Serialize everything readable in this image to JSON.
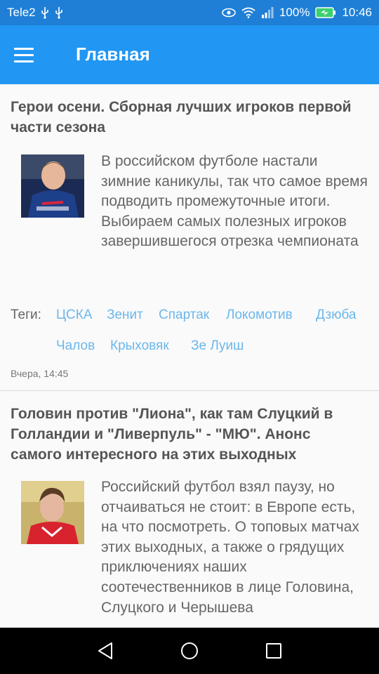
{
  "status_bar": {
    "carrier": "Tele2",
    "battery": "100%",
    "time": "10:46"
  },
  "app_bar": {
    "title": "Главная"
  },
  "tags_label": "Теги:",
  "articles": [
    {
      "title": "Герои осени. Сборная лучших игроков первой части сезона",
      "text": "В российском футболе настали зимние каникулы, так что самое время подводить промежуточные итоги. Выбираем самых полезных игроков завершившегося отрезка чемпионата",
      "tags": [
        "ЦСКА",
        "Зенит",
        "Спартак",
        "Локомотив",
        "Дзюба",
        "Чалов",
        "Крыховяк",
        "Зе Луиш"
      ],
      "date": "Вчера, 14:45"
    },
    {
      "title": "Головин против \"Лиона\", как там Слуцкий в Голландии и \"Ливерпуль\" - \"МЮ\". Анонс самого интересного на этих выходных",
      "text": "Российский футбол взял паузу, но отчаиваться не стоит: в Европе есть, на что посмотреть. О топовых матчах этих выходных, а также о грядущих приключениях наших соотечественников в лице Головина, Слуцкого и Черышева"
    }
  ],
  "colors": {
    "status_bar": "#1f7fd6",
    "app_bar": "#2196f3",
    "tag": "#6bb7ec"
  }
}
